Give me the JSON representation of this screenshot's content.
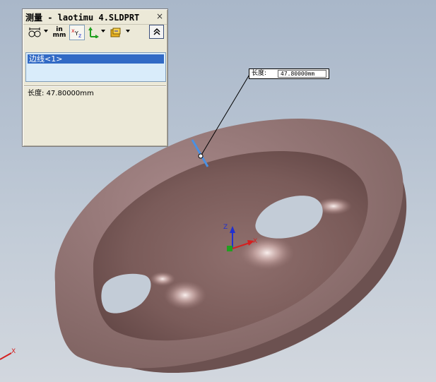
{
  "window": {
    "title": "测量 - laotimu 4.SLDPRT",
    "close_glyph": "×"
  },
  "toolbar": {
    "arc_circle_options": "arc-circle-measure-icon",
    "units_label_top": "in",
    "units_label_bottom": "mm",
    "xyz_label": "xYz",
    "point_coordinates": "point-axes-icon",
    "projection": "projection-icon",
    "collapse": "chevron-up-icon"
  },
  "selection": {
    "items": [
      "边线<1>"
    ]
  },
  "results": {
    "length_label": "长度:",
    "length_value": "47.80000mm"
  },
  "callout": {
    "label": "长度:",
    "value": "47.80000mm"
  },
  "triad": {
    "x": "X",
    "y": "Y",
    "z": "Z"
  },
  "colors": {
    "part_face": "#8e6f6d",
    "part_inner": "#70514f",
    "selected_edge": "#4a90e2",
    "triad_x": "#d42020",
    "triad_y": "#20a020",
    "triad_z": "#2030d0"
  }
}
